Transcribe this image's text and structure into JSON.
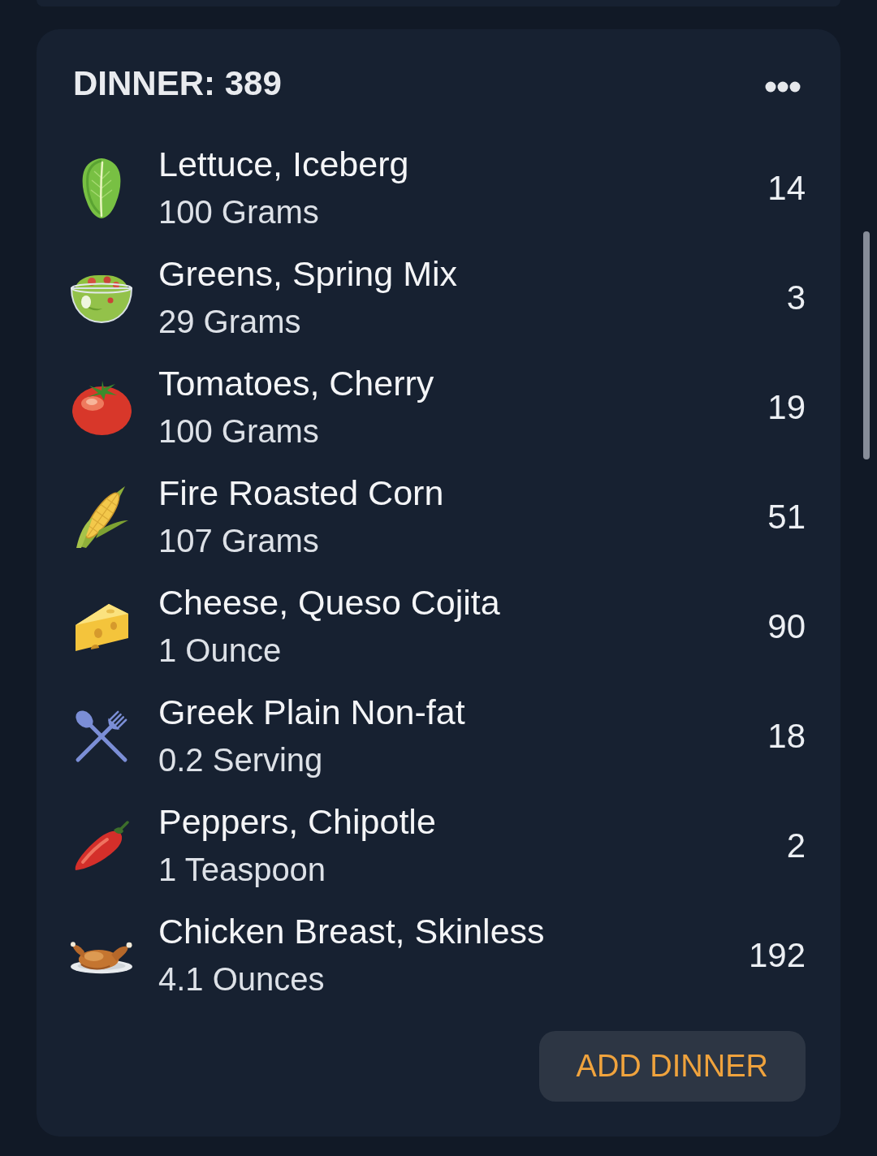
{
  "meal_card": {
    "title": "DINNER: 389",
    "items": [
      {
        "name": "Lettuce, Iceberg",
        "serving": "100 Grams",
        "calories": "14"
      },
      {
        "name": "Greens, Spring Mix",
        "serving": "29 Grams",
        "calories": "3"
      },
      {
        "name": "Tomatoes, Cherry",
        "serving": "100 Grams",
        "calories": "19"
      },
      {
        "name": "Fire Roasted Corn",
        "serving": "107 Grams",
        "calories": "51"
      },
      {
        "name": "Cheese, Queso Cojita",
        "serving": "1 Ounce",
        "calories": "90"
      },
      {
        "name": "Greek Plain Non-fat",
        "serving": "0.2 Serving",
        "calories": "18"
      },
      {
        "name": "Peppers, Chipotle",
        "serving": "1 Teaspoon",
        "calories": "2"
      },
      {
        "name": "Chicken Breast, Skinless",
        "serving": "4.1 Ounces",
        "calories": "192"
      }
    ],
    "add_button": "ADD DINNER"
  }
}
